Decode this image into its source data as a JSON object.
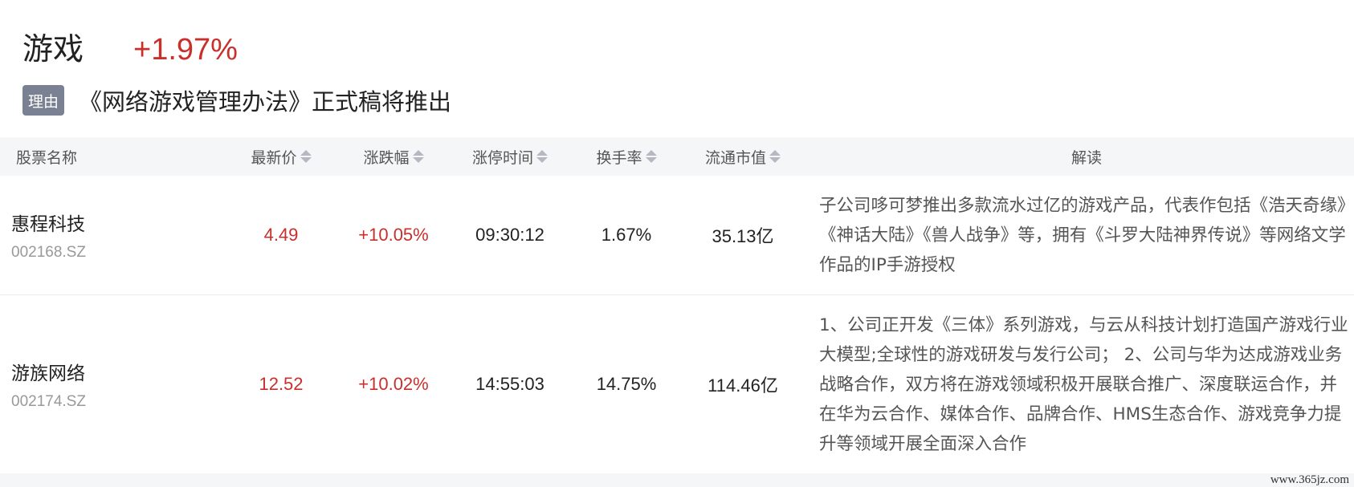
{
  "sector": {
    "name": "游戏",
    "change": "+1.97%"
  },
  "reason": {
    "tag": "理由",
    "text": "《网络游戏管理办法》正式稿将推出"
  },
  "table": {
    "headers": {
      "name": "股票名称",
      "price": "最新价",
      "change": "涨跌幅",
      "limit_time": "涨停时间",
      "turnover": "换手率",
      "market_cap": "流通市值",
      "interpretation": "解读"
    },
    "rows": [
      {
        "name": "惠程科技",
        "code": "002168.SZ",
        "price": "4.49",
        "change": "+10.05%",
        "limit_time": "09:30:12",
        "turnover": "1.67%",
        "market_cap": "35.13亿",
        "interpretation": "子公司哆可梦推出多款流水过亿的游戏产品，代表作包括《浩天奇缘》《神话大陆》《兽人战争》等，拥有《斗罗大陆神界传说》等网络文学作品的IP手游授权"
      },
      {
        "name": "游族网络",
        "code": "002174.SZ",
        "price": "12.52",
        "change": "+10.02%",
        "limit_time": "14:55:03",
        "turnover": "14.75%",
        "market_cap": "114.46亿",
        "interpretation": "1、公司正开发《三体》系列游戏，与云从科技计划打造国产游戏行业大模型;全球性的游戏研发与发行公司； 2、公司与华为达成游戏业务战略合作，双方将在游戏领域积极开展联合推广、深度联运合作，并在华为云合作、媒体合作、品牌合作、HMS生态合作、游戏竞争力提升等领域开展全面深入合作"
      }
    ]
  },
  "colors": {
    "up": "#c8302c",
    "tag_bg": "#7a8193",
    "header_bg": "#f5f6f8"
  },
  "watermark": "www.365jz.com"
}
